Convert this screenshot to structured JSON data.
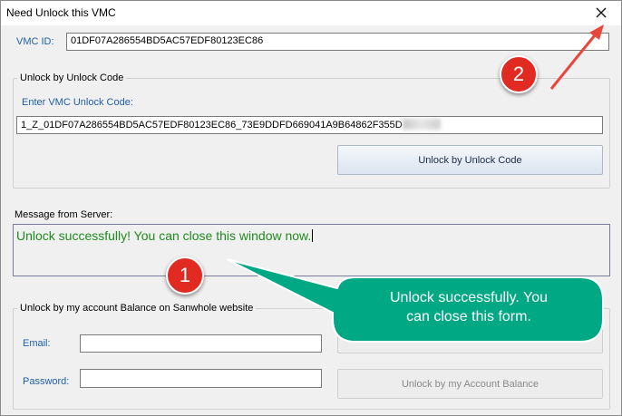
{
  "window": {
    "title": "Need Unlock this VMC",
    "close_icon": "close-icon"
  },
  "vmc_id": {
    "label": "VMC ID:",
    "value": "01DF07A286554BD5AC57EDF80123EC86"
  },
  "unlock_code_group": {
    "title": "Unlock by Unlock Code",
    "enter_label": "Enter VMC Unlock Code:",
    "code_value": "1_Z_01DF07A286554BD5AC57EDF80123EC86_73E9DDFD669041A9B64862F355D",
    "button_label": "Unlock by Unlock Code"
  },
  "server_message": {
    "label": "Message from Server:",
    "text": "Unlock successfully! You can close this window now."
  },
  "balance_group": {
    "title": "Unlock by my account Balance on Sanwhole website",
    "email_label": "Email:",
    "email_value": "",
    "password_label": "Password:",
    "password_value": "",
    "button_label": "Unlock by my Account Balance"
  },
  "annotations": {
    "badge_1": "1",
    "badge_2": "2",
    "callout_line1": "Unlock successfully. You",
    "callout_line2": "can close this form.",
    "callout_color": "#00a884",
    "badge_color": "#e02a22",
    "arrow_color": "#e8453c"
  },
  "colors": {
    "success_text": "#1e8b1e",
    "label_blue": "#1f5ea8"
  }
}
